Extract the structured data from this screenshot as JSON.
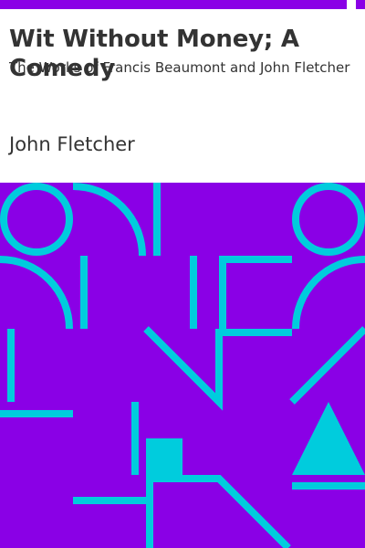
{
  "book": {
    "title": "Wit Without Money; A Comedy",
    "subtitle": "The Works of Francis Beaumont and John Fletcher",
    "author": "John Fletcher"
  },
  "colors": {
    "background": "#8a00e6",
    "pattern": "#00ccdd",
    "panel": "#ffffff",
    "text": "#333333"
  }
}
